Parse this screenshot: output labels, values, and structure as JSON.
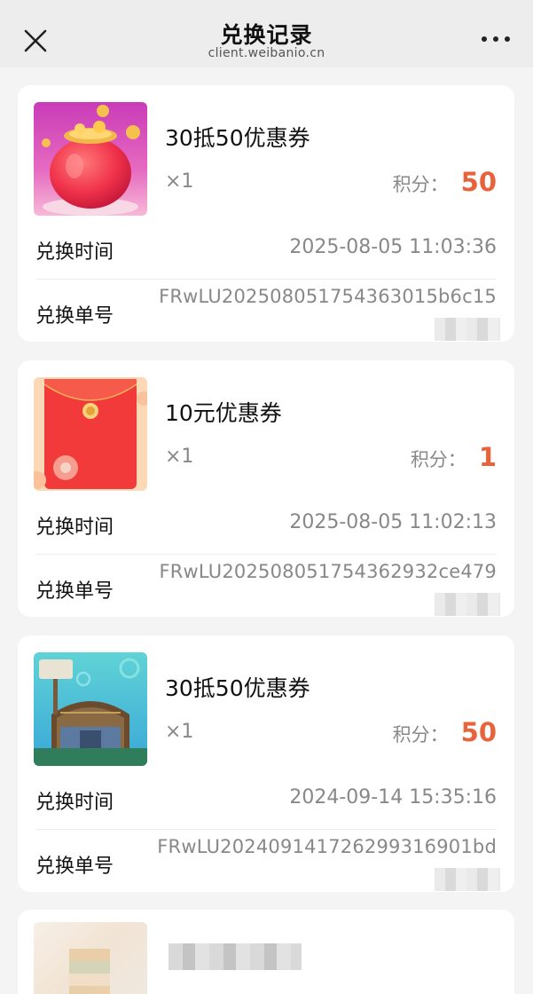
{
  "header": {
    "title": "兑换记录",
    "subtitle": "client.weibanio.cn",
    "close_icon": "close-icon",
    "more_icon": "more-dots-icon"
  },
  "labels": {
    "time": "兑换时间",
    "order": "兑换单号",
    "points": "积分："
  },
  "colors": {
    "accent": "#e8633a",
    "page_bg": "#f4f4f4",
    "card_bg": "#ffffff"
  },
  "records": [
    {
      "name": "30抵50优惠券",
      "qty": "×1",
      "points": "50",
      "time": "2025-08-05 11:03:36",
      "order_no": "FRwLU20250805175436301​5b6c15",
      "thumb": "lucky-bag-image"
    },
    {
      "name": "10元优惠券",
      "qty": "×1",
      "points": "1",
      "time": "2025-08-05 11:02:13",
      "order_no": "FRwLU20250805175436293​2ce479",
      "thumb": "red-envelope-image"
    },
    {
      "name": "30抵50优惠券",
      "qty": "×1",
      "points": "50",
      "time": "2024-09-14 15:35:16",
      "order_no": "FRwLU20240914172629931​6901bd",
      "thumb": "krusty-krab-image"
    }
  ]
}
